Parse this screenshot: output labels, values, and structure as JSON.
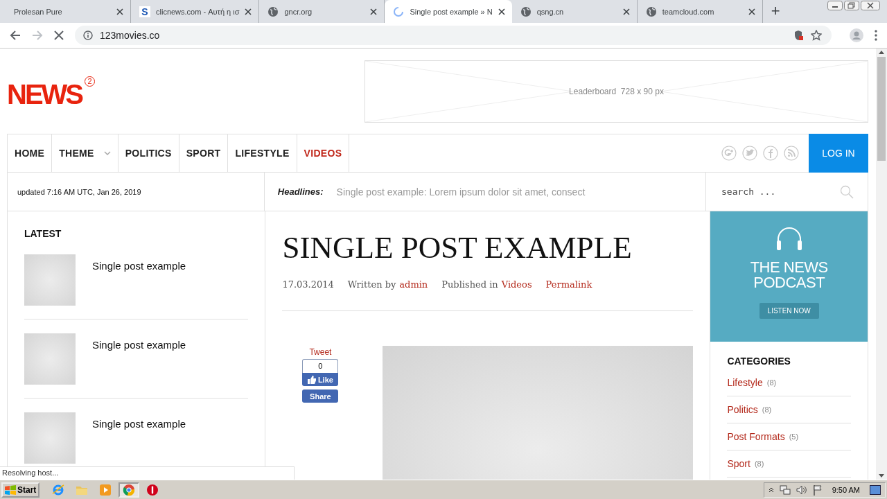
{
  "browser": {
    "tabs": [
      {
        "title": "Prolesan Pure",
        "kind": "plain",
        "selected": false
      },
      {
        "title": "clicnews.com - Αυτή η ισ",
        "kind": "letter",
        "selected": false
      },
      {
        "title": "gncr.org",
        "kind": "globe",
        "selected": false
      },
      {
        "title": "Single post example » N",
        "kind": "loading",
        "selected": true
      },
      {
        "title": "qsng.cn",
        "kind": "globe",
        "selected": false
      },
      {
        "title": "teamcloud.com",
        "kind": "globe",
        "selected": false
      }
    ],
    "favicon_letter": "S",
    "new_tab": "+",
    "address": "123movies.co"
  },
  "site": {
    "logo": "NEWS",
    "logo_badge": "2",
    "ad": "Leaderboard  728 x 90 px",
    "nav": [
      {
        "label": "HOME",
        "selected": false,
        "dropdown": false
      },
      {
        "label": "THEME",
        "selected": false,
        "dropdown": true
      },
      {
        "label": "POLITICS",
        "selected": false,
        "dropdown": false
      },
      {
        "label": "SPORT",
        "selected": false,
        "dropdown": false
      },
      {
        "label": "LIFESTYLE",
        "selected": false,
        "dropdown": false
      },
      {
        "label": "VIDEOS",
        "selected": true,
        "dropdown": false
      }
    ],
    "login": "LOG IN",
    "updated": "updated 7:16 AM UTC, Jan 26, 2019",
    "headlines_label": "Headlines:",
    "headline": "Single post example: Lorem ipsum dolor sit amet, consect",
    "search": {
      "placeholder": "search ..."
    }
  },
  "latest": {
    "title": "LATEST",
    "items": [
      {
        "title": "Single post example"
      },
      {
        "title": "Single post example"
      },
      {
        "title": "Single post example"
      }
    ]
  },
  "post": {
    "title": "SINGLE POST EXAMPLE",
    "date": "17.03.2014",
    "written_by": "Written by",
    "author": "admin",
    "published_in": "Published in",
    "category": "Videos",
    "permalink": "Permalink",
    "tweet": "Tweet",
    "like_count": "0",
    "like": "Like",
    "share": "Share"
  },
  "promo": {
    "title_lines": [
      "THE NEWS",
      "PODCAST"
    ],
    "button": "LISTEN NOW"
  },
  "categories": {
    "title": "CATEGORIES",
    "items": [
      {
        "name": "Lifestyle",
        "count": "(8)"
      },
      {
        "name": "Politics",
        "count": "(8)"
      },
      {
        "name": "Post Formats",
        "count": "(5)"
      },
      {
        "name": "Sport",
        "count": "(8)"
      }
    ]
  },
  "status": "Resolving host...",
  "taskbar": {
    "start": "Start",
    "apps": [
      {
        "kind": "ie",
        "selected": false
      },
      {
        "kind": "folder",
        "selected": false
      },
      {
        "kind": "media",
        "selected": false
      },
      {
        "kind": "chrome",
        "selected": true
      },
      {
        "kind": "stop",
        "selected": false
      }
    ],
    "time": "9:50 AM"
  }
}
